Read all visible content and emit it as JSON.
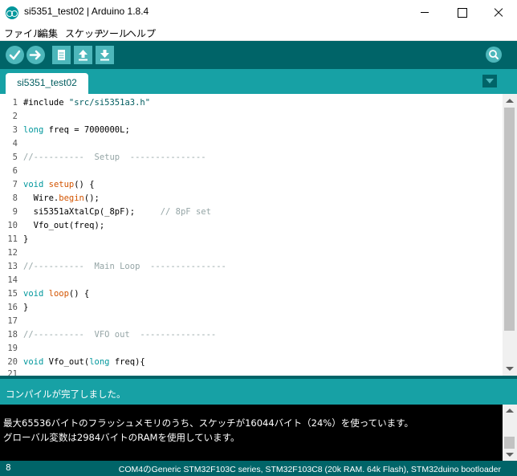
{
  "window": {
    "title": "si5351_test02 | Arduino 1.8.4"
  },
  "menu": {
    "items": [
      "ファイル",
      "編集",
      "スケッチ",
      "ツール",
      "ヘルプ"
    ]
  },
  "toolbar": {
    "icons": [
      "verify-icon",
      "upload-icon",
      "new-icon",
      "open-icon",
      "save-icon",
      "serial-monitor-icon"
    ]
  },
  "tabs": {
    "active": "si5351_test02"
  },
  "editor": {
    "lines": [
      {
        "n": "1",
        "t": "#include \"src/si5351a3.h\""
      },
      {
        "n": "2",
        "t": ""
      },
      {
        "n": "3",
        "t": "long freq = 7000000L;"
      },
      {
        "n": "4",
        "t": ""
      },
      {
        "n": "5",
        "t": "//----------  Setup  ---------------"
      },
      {
        "n": "6",
        "t": ""
      },
      {
        "n": "7",
        "t": "void setup() {"
      },
      {
        "n": "8",
        "t": "  Wire.begin();"
      },
      {
        "n": "9",
        "t": "  si5351aXtalCp(_8pF);     // 8pF set"
      },
      {
        "n": "10",
        "t": "  Vfo_out(freq);"
      },
      {
        "n": "11",
        "t": "}"
      },
      {
        "n": "12",
        "t": ""
      },
      {
        "n": "13",
        "t": "//----------  Main Loop  ---------------"
      },
      {
        "n": "14",
        "t": ""
      },
      {
        "n": "15",
        "t": "void loop() {"
      },
      {
        "n": "16",
        "t": "}"
      },
      {
        "n": "17",
        "t": ""
      },
      {
        "n": "18",
        "t": "//----------  VFO out  ---------------"
      },
      {
        "n": "19",
        "t": ""
      },
      {
        "n": "20",
        "t": "void Vfo_out(long freq){"
      }
    ]
  },
  "status": {
    "message": "コンパイルが完了しました。"
  },
  "console": {
    "lines": [
      "最大65536バイトのフラッシュメモリのうち、スケッチが16044バイト（24%）を使っています。",
      "グローバル変数は2984バイトのRAMを使用しています。"
    ]
  },
  "footer": {
    "line_number": "8",
    "board": "COM4のGeneric STM32F103C series, STM32F103C8 (20k RAM. 64k Flash), STM32duino bootloader"
  },
  "colors": {
    "toolbar": "#006468",
    "tabbar": "#17a1a5",
    "keyword": "#00979c",
    "function": "#d35400",
    "comment": "#95a5a6"
  }
}
